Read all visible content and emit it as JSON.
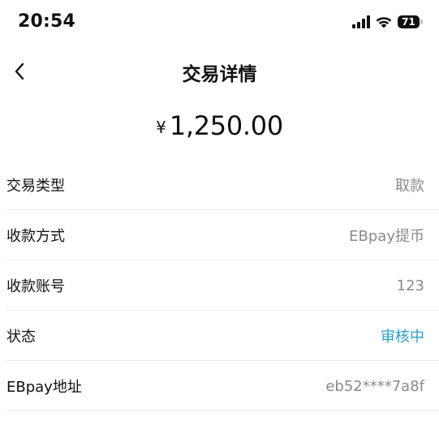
{
  "status_bar": {
    "time": "20:54",
    "battery": "71"
  },
  "header": {
    "title": "交易详情"
  },
  "amount": {
    "currency": "¥",
    "value": "1,250.00"
  },
  "details": [
    {
      "label": "交易类型",
      "value": "取款"
    },
    {
      "label": "收款方式",
      "value": "EBpay提币"
    },
    {
      "label": "收款账号",
      "value": "123"
    },
    {
      "label": "状态",
      "value": "审核中"
    },
    {
      "label": "EBpay地址",
      "value": "eb52****7a8f"
    }
  ],
  "colors": {
    "status_accent": "#2a9fc9",
    "value_gray": "#8a8a8a",
    "divider": "#ececec"
  },
  "icons": {
    "back": "chevron-left-icon",
    "signal": "cellular-signal-icon",
    "wifi": "wifi-icon",
    "battery": "battery-icon"
  }
}
